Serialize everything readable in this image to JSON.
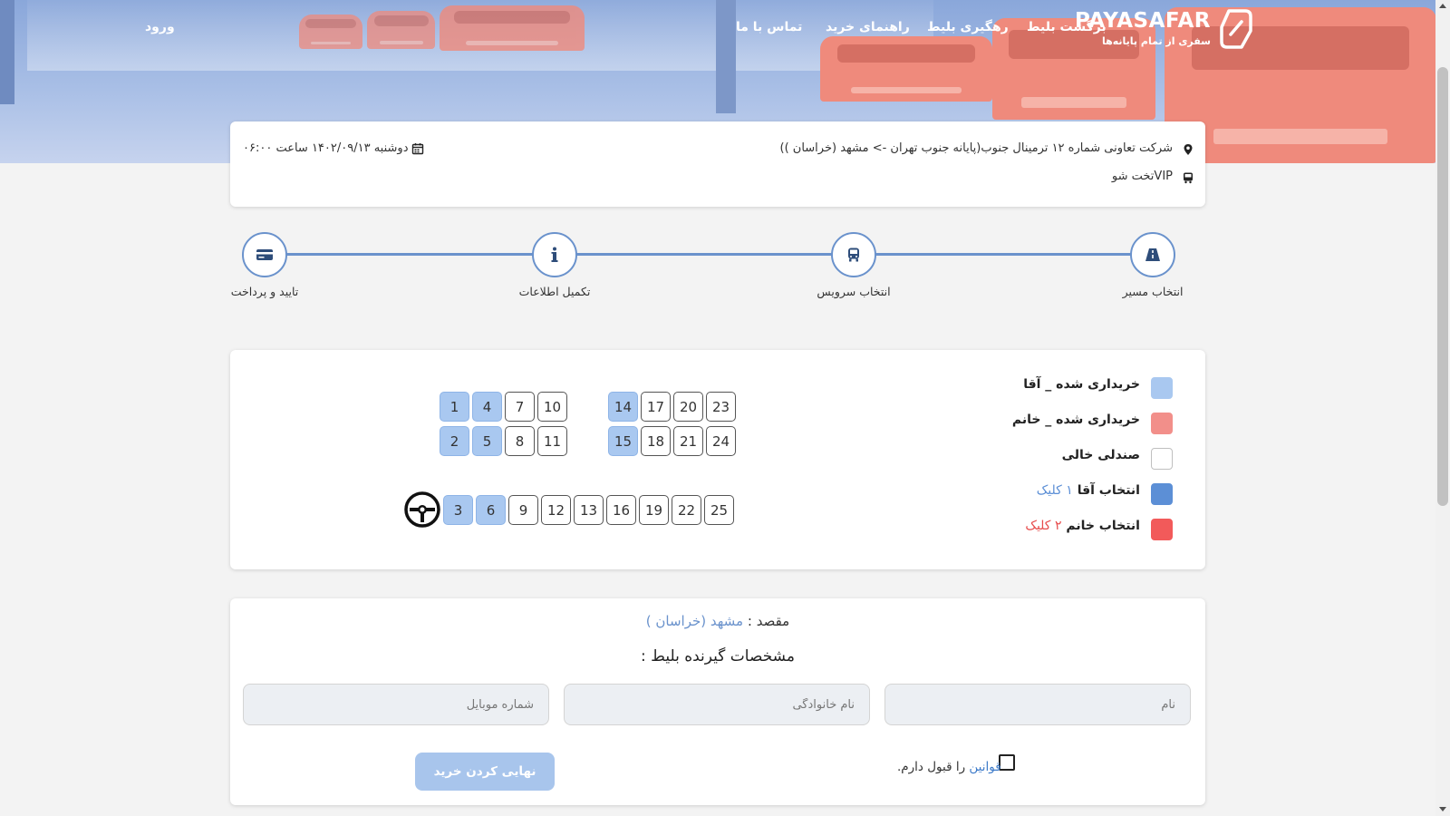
{
  "header": {
    "brand_name": "PAYASAFAR",
    "brand_tagline": "سفری از تمام پایانه‌ها",
    "nav": {
      "return_ticket": "برگشت بلیط",
      "track_ticket": "رهگیری بلیط",
      "purchase_guide": "راهنمای خرید",
      "contact_us": "تماس با ما",
      "login": "ورود"
    }
  },
  "trip": {
    "route": "شرکت تعاونی شماره ۱۲ ترمینال جنوب(پایانه جنوب تهران -> مشهد (خراسان ))",
    "datetime": "دوشنبه ۱۴۰۲/۰۹/۱۳ ساعت ۰۶:۰۰",
    "bus_type": "VIPتخت شو"
  },
  "steps": [
    {
      "label": "انتخاب مسیر",
      "icon": "road-icon"
    },
    {
      "label": "انتخاب سرویس",
      "icon": "bus-icon"
    },
    {
      "label": "تکمیل اطلاعات",
      "icon": "info-icon"
    },
    {
      "label": "تایید و پرداخت",
      "icon": "credit-card-icon"
    }
  ],
  "legend": [
    {
      "text": "خریداری شده _ آقا",
      "color": "#a9c8f0",
      "border": "#a9c8f0"
    },
    {
      "text": "خریداری شده _ خانم",
      "color": "#f28f8a",
      "border": "#f28f8a"
    },
    {
      "text": "صندلی خالی",
      "color": "#ffffff",
      "border": "#bfbfbf"
    },
    {
      "text": "انتخاب آقا",
      "click": "۱ کلیک",
      "color": "#5c8fd6",
      "border": "#5c8fd6",
      "click_color": "#5c8fd6"
    },
    {
      "text": "انتخاب خانم",
      "click": "۲ کلیک",
      "color": "#f25a5a",
      "border": "#f25a5a",
      "click_color": "#e74c4c"
    }
  ],
  "seats": {
    "row1": [
      {
        "n": "1",
        "booked": true
      },
      {
        "n": "4",
        "booked": true
      },
      {
        "n": "7",
        "booked": false
      },
      {
        "n": "10",
        "booked": false
      },
      {
        "n": "14",
        "booked": true
      },
      {
        "n": "17",
        "booked": false
      },
      {
        "n": "20",
        "booked": false
      },
      {
        "n": "23",
        "booked": false
      }
    ],
    "row2": [
      {
        "n": "2",
        "booked": true
      },
      {
        "n": "5",
        "booked": true
      },
      {
        "n": "8",
        "booked": false
      },
      {
        "n": "11",
        "booked": false
      },
      {
        "n": "15",
        "booked": true
      },
      {
        "n": "18",
        "booked": false
      },
      {
        "n": "21",
        "booked": false
      },
      {
        "n": "24",
        "booked": false
      }
    ],
    "row3": [
      {
        "n": "3",
        "booked": true
      },
      {
        "n": "6",
        "booked": true
      },
      {
        "n": "9",
        "booked": false
      },
      {
        "n": "12",
        "booked": false
      },
      {
        "n": "13",
        "booked": false
      },
      {
        "n": "16",
        "booked": false
      },
      {
        "n": "19",
        "booked": false
      },
      {
        "n": "22",
        "booked": false
      },
      {
        "n": "25",
        "booked": false
      }
    ]
  },
  "form": {
    "destination_label": "مقصد :",
    "destination_value": "مشهد (خراسان )",
    "title": "مشخصات گیرنده بلیط :",
    "first_name_placeholder": "نام",
    "last_name_placeholder": "نام خانوادگی",
    "mobile_placeholder": "شماره موبایل",
    "terms_link": "قوانین",
    "terms_text": "را قبول دارم.",
    "submit_label": "نهایی کردن خرید"
  },
  "colors": {
    "accent": "#6a92cc",
    "seat_booked_male": "#a9c8f0",
    "submit_bg": "#a8c5ec"
  }
}
